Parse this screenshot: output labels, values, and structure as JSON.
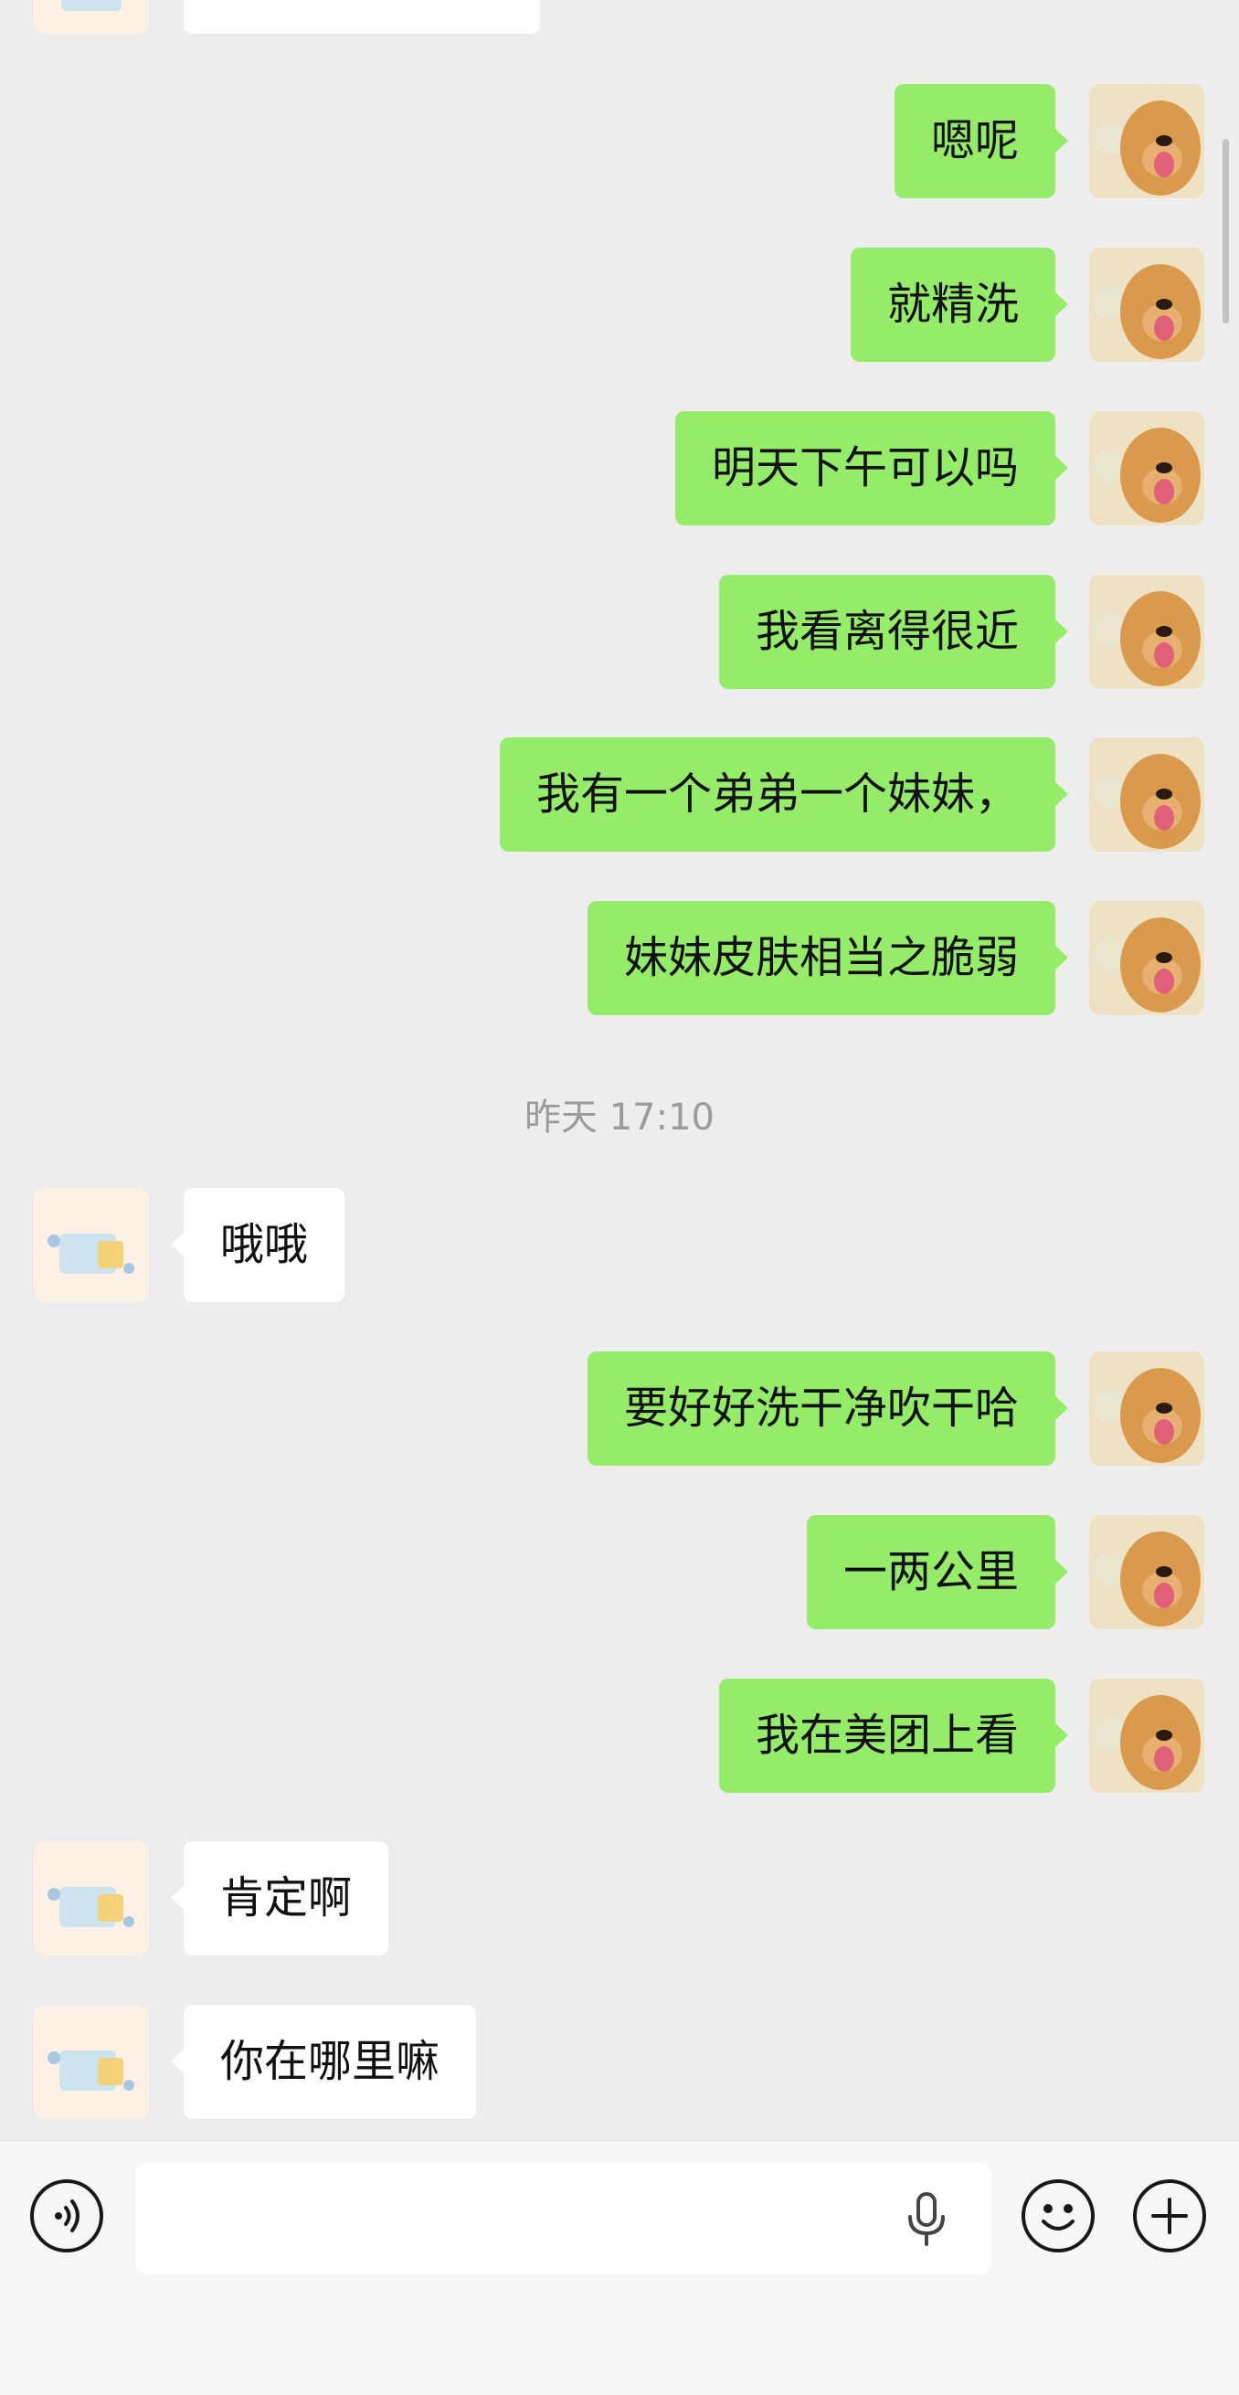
{
  "messages": [
    {
      "side": "me",
      "text": "嗯呢"
    },
    {
      "side": "me",
      "text": "就精洗"
    },
    {
      "side": "me",
      "text": "明天下午可以吗"
    },
    {
      "side": "me",
      "text": "我看离得很近"
    },
    {
      "side": "me",
      "text": "我有一个弟弟一个妹妹，"
    },
    {
      "side": "me",
      "text": "妹妹皮肤相当之脆弱"
    },
    {
      "side": "them",
      "text": "哦哦"
    },
    {
      "side": "me",
      "text": "要好好洗干净吹干哈"
    },
    {
      "side": "me",
      "text": "一两公里"
    },
    {
      "side": "me",
      "text": "我在美团上看"
    },
    {
      "side": "them",
      "text": "肯定啊"
    },
    {
      "side": "them",
      "text": "你在哪里嘛"
    }
  ],
  "timestamp": "昨天 17:10",
  "input": {
    "value": "",
    "placeholder": ""
  },
  "icons": {
    "voice": "voice-wave-icon",
    "mic": "microphone-icon",
    "emoji": "smiley-icon",
    "plus": "plus-icon"
  },
  "colors": {
    "background": "#ededed",
    "my_bubble": "#95ec69",
    "their_bubble": "#ffffff",
    "timestamp_text": "#9b9b9b"
  }
}
